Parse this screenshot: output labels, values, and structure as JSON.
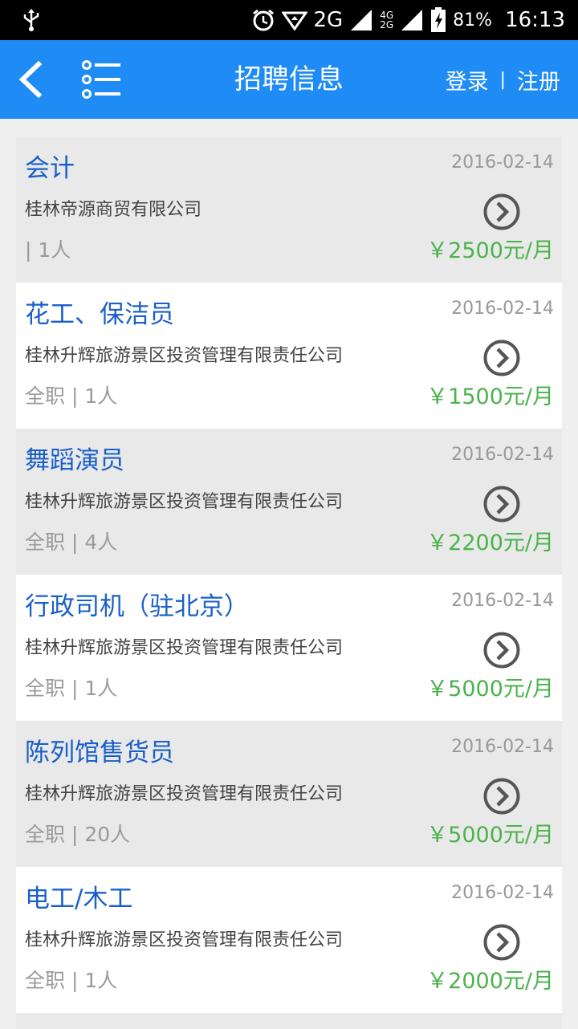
{
  "status_bar": {
    "network_label": "2G",
    "network_small_top": "4G",
    "network_small_bottom": "2G",
    "battery_percent": "81%",
    "time": "16:13"
  },
  "app_bar": {
    "title": "招聘信息",
    "login_label": "登录",
    "separator": "|",
    "register_label": "注册",
    "back_icon": "chevron-left-icon",
    "menu_icon": "list-icon",
    "color": "#1e8cf4"
  },
  "jobs": [
    {
      "title": "会计",
      "date": "2016-02-14",
      "company": "桂林帝源商贸有限公司",
      "meta": "| 1人",
      "salary": "￥2500元/月"
    },
    {
      "title": "花工、保洁员",
      "date": "2016-02-14",
      "company": "桂林升辉旅游景区投资管理有限责任公司",
      "meta": "全职 | 1人",
      "salary": "￥1500元/月"
    },
    {
      "title": "舞蹈演员",
      "date": "2016-02-14",
      "company": "桂林升辉旅游景区投资管理有限责任公司",
      "meta": "全职 | 4人",
      "salary": "￥2200元/月"
    },
    {
      "title": "行政司机（驻北京）",
      "date": "2016-02-14",
      "company": "桂林升辉旅游景区投资管理有限责任公司",
      "meta": "全职 | 1人",
      "salary": "￥5000元/月"
    },
    {
      "title": "陈列馆售货员",
      "date": "2016-02-14",
      "company": "桂林升辉旅游景区投资管理有限责任公司",
      "meta": "全职 | 20人",
      "salary": "￥5000元/月"
    },
    {
      "title": "电工/木工",
      "date": "2016-02-14",
      "company": "桂林升辉旅游景区投资管理有限责任公司",
      "meta": "全职 | 1人",
      "salary": "￥2000元/月"
    }
  ],
  "colors": {
    "title": "#1a5fc9",
    "salary": "#4bb34b",
    "date": "#999999"
  }
}
